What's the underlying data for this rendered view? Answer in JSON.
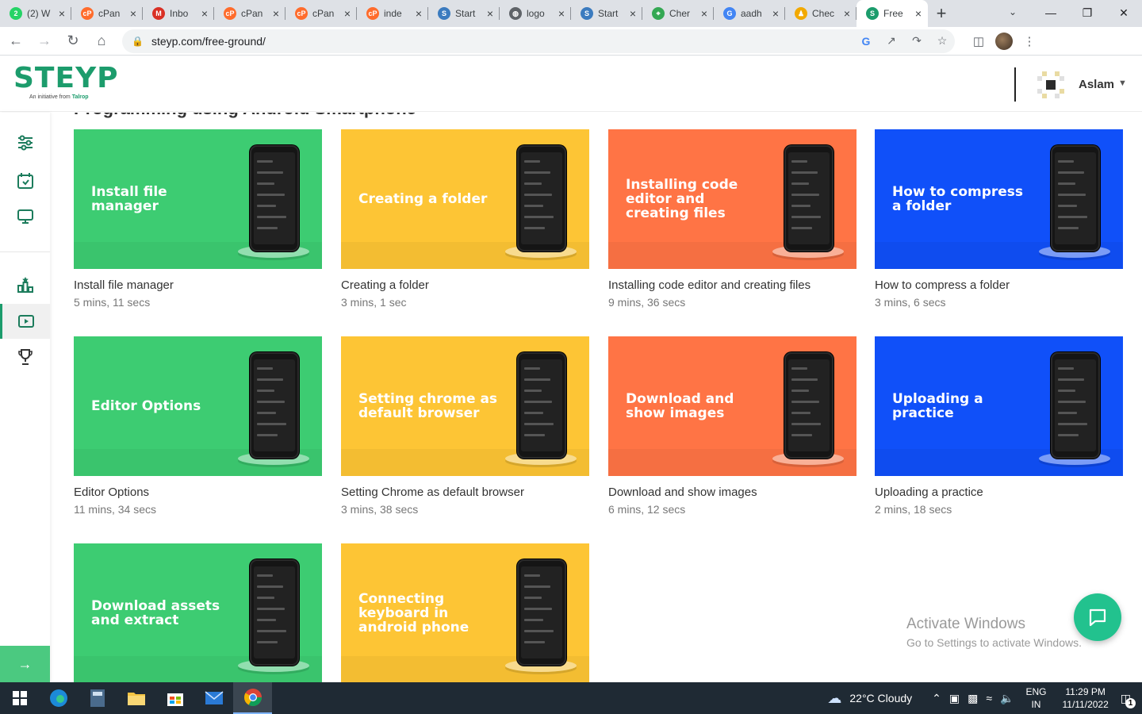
{
  "browser": {
    "tabs": [
      {
        "title": "(2) W",
        "icon_color": "#25d366",
        "icon_glyph": "2"
      },
      {
        "title": "cPan",
        "icon_color": "#ff6c2c",
        "icon_glyph": "cP"
      },
      {
        "title": "Inbo",
        "icon_color": "#d93025",
        "icon_glyph": "M"
      },
      {
        "title": "cPan",
        "icon_color": "#ff6c2c",
        "icon_glyph": "cP"
      },
      {
        "title": "cPan",
        "icon_color": "#ff6c2c",
        "icon_glyph": "cP"
      },
      {
        "title": "inde",
        "icon_color": "#ff6c2c",
        "icon_glyph": "cP"
      },
      {
        "title": "Start",
        "icon_color": "#3b7bbf",
        "icon_glyph": "S"
      },
      {
        "title": "logo",
        "icon_color": "#5f6368",
        "icon_glyph": "◍"
      },
      {
        "title": "Start",
        "icon_color": "#3b7bbf",
        "icon_glyph": "S"
      },
      {
        "title": "Cher",
        "icon_color": "#34a853",
        "icon_glyph": "⌖"
      },
      {
        "title": "aadh",
        "icon_color": "#4285f4",
        "icon_glyph": "G"
      },
      {
        "title": "Chec",
        "icon_color": "#f2a900",
        "icon_glyph": "♟"
      },
      {
        "title": "Free",
        "icon_color": "#1c9c6c",
        "icon_glyph": "S",
        "active": true
      }
    ],
    "url": "steyp.com/free-ground/"
  },
  "header": {
    "logo_text": "STEYP",
    "logo_tagline": "An initiative from",
    "logo_tagline_brand": "Talrop",
    "user_name": "Aslam"
  },
  "main": {
    "section_title": "Programming using Android Smartphone",
    "cards": [
      {
        "thumb_text": "Install file manager",
        "title": "Install file manager",
        "duration": "5 mins, 11 secs",
        "color": "#3dcc72"
      },
      {
        "thumb_text": "Creating a folder",
        "title": "Creating a folder",
        "duration": "3 mins, 1 sec",
        "color": "#fdc535"
      },
      {
        "thumb_text": "Installing code editor and creating files",
        "title": "Installing code editor and creating files",
        "duration": "9 mins, 36 secs",
        "color": "#ff7445"
      },
      {
        "thumb_text": "How to compress a folder",
        "title": "How to compress a folder",
        "duration": "3 mins, 6 secs",
        "color": "#1050f9"
      },
      {
        "thumb_text": "Editor Options",
        "title": "Editor Options",
        "duration": "11 mins, 34 secs",
        "color": "#3dcc72"
      },
      {
        "thumb_text": "Setting chrome as default browser",
        "title": "Setting Chrome as default browser",
        "duration": "3 mins, 38 secs",
        "color": "#fdc535"
      },
      {
        "thumb_text": "Download and show images",
        "title": "Download and show images",
        "duration": "6 mins, 12 secs",
        "color": "#ff7445"
      },
      {
        "thumb_text": "Uploading a practice",
        "title": "Uploading a practice",
        "duration": "2 mins, 18 secs",
        "color": "#1050f9"
      },
      {
        "thumb_text": "Download assets and extract",
        "title": "",
        "duration": "",
        "color": "#3dcc72"
      },
      {
        "thumb_text": "Connecting keyboard in android phone",
        "title": "",
        "duration": "",
        "color": "#fdc535"
      }
    ]
  },
  "watermark": {
    "line1": "Activate Windows",
    "line2": "Go to Settings to activate Windows."
  },
  "taskbar": {
    "weather": "22°C  Cloudy",
    "lang_top": "ENG",
    "lang_bottom": "IN",
    "time": "11:29 PM",
    "date": "11/11/2022",
    "notification_count": "1"
  }
}
